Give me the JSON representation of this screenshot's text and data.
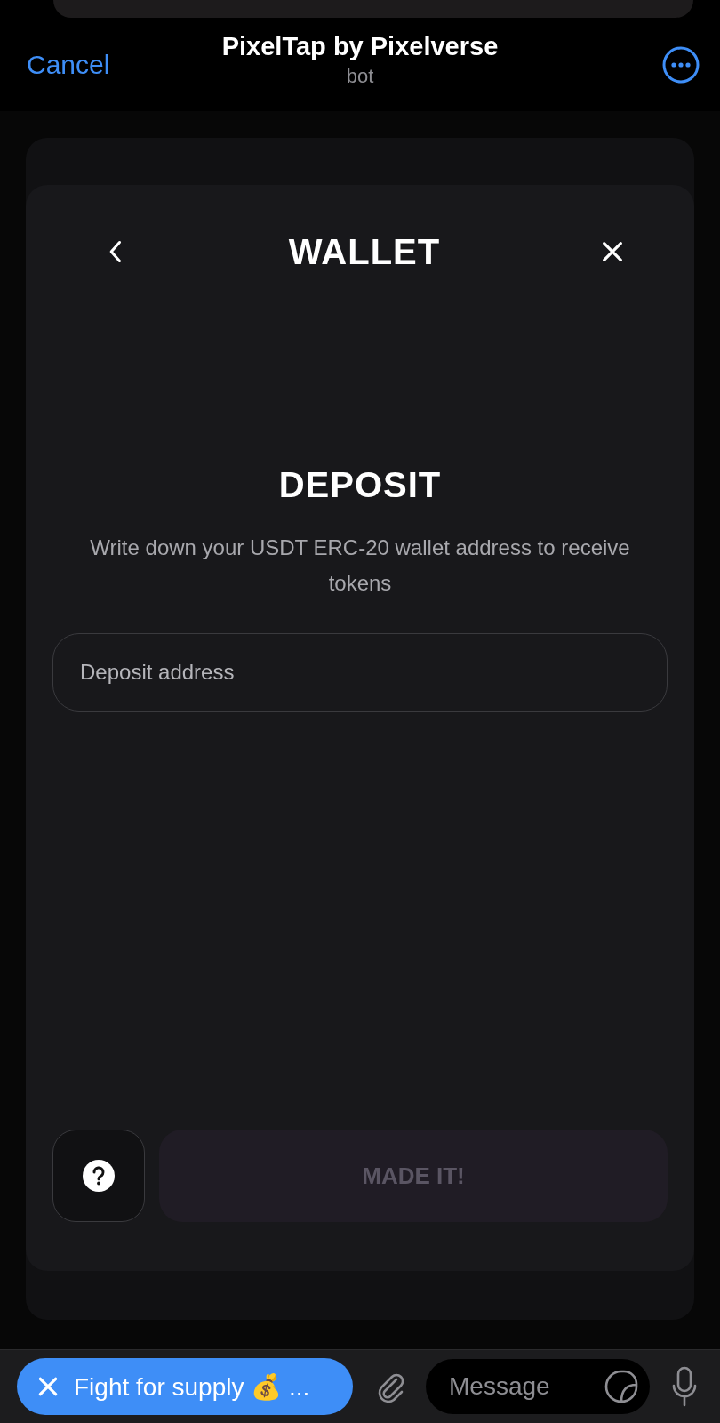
{
  "header": {
    "cancel": "Cancel",
    "title": "PixelTap by Pixelverse",
    "subtitle": "bot"
  },
  "modal": {
    "title": "WALLET",
    "heading": "DEPOSIT",
    "description": "Write down your USDT ERC-20 wallet address to receive tokens",
    "input": {
      "placeholder": "Deposit address"
    },
    "submit": {
      "label": "MADE IT!",
      "disabled": true
    }
  },
  "bottom_bar": {
    "bot_button": "Fight for supply 💰 ...",
    "message": {
      "placeholder": "Message"
    }
  }
}
